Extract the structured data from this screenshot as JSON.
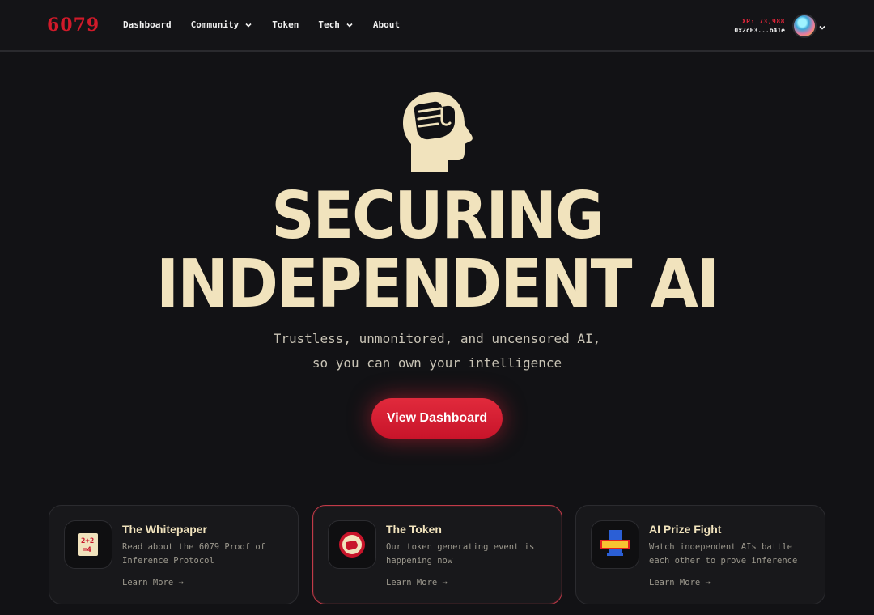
{
  "nav": {
    "logo": "6079",
    "links": [
      {
        "label": "Dashboard",
        "has_dropdown": false
      },
      {
        "label": "Community",
        "has_dropdown": true
      },
      {
        "label": "Token",
        "has_dropdown": false
      },
      {
        "label": "Tech",
        "has_dropdown": true
      },
      {
        "label": "About",
        "has_dropdown": false
      }
    ],
    "wallet": {
      "xp": "XP: 73,988",
      "address": "0x2cE3...b41e"
    },
    "icons": {
      "dropdown": "chevron-down-icon",
      "avatar": "user-avatar"
    }
  },
  "hero": {
    "icon": "head-fist-icon",
    "headline_line1": "SECURING",
    "headline_line2": "INDEPENDENT AI",
    "subtitle_line1": "Trustless, unmonitored, and uncensored AI,",
    "subtitle_line2": "so you can own your intelligence",
    "cta_label": "View Dashboard"
  },
  "cards": [
    {
      "icon": "calculator-icon",
      "title": "The Whitepaper",
      "description": "Read about the 6079 Proof of Inference Protocol",
      "link": "Learn More →",
      "active": false
    },
    {
      "icon": "token-fist-icon",
      "title": "The Token",
      "description": "Our token generating event is happening now",
      "link": "Learn More →",
      "active": true
    },
    {
      "icon": "prize-fight-icon",
      "title": "AI Prize Fight",
      "description": "Watch independent AIs battle each other to prove inference",
      "link": "Learn More →",
      "active": false
    }
  ],
  "colors": {
    "background": "#121215",
    "accent_red": "#d11a2a",
    "cream": "#f1e3bd",
    "muted_text": "#9c988d"
  }
}
